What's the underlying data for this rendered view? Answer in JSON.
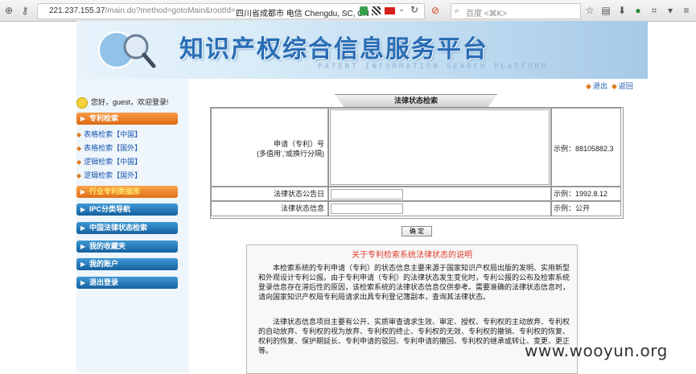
{
  "browser": {
    "url_host": "221.237.155.37",
    "url_path": "/main.do?method=gotoMain&rootId=",
    "geo_location": "四川省成都市 电信  Chengdu, SC, CN",
    "search_placeholder": "百度 <⌘K>"
  },
  "banner": {
    "title": "知识产权综合信息服务平台",
    "subtitle": "PATENT INFORMATION SEARCH PLATFORM"
  },
  "top_links": {
    "logout": "退出",
    "back": "返回"
  },
  "sidebar": {
    "welcome": "您好，guest，欢迎登录!",
    "section_patent": "专利检索",
    "sublinks": [
      "表格检索【中国】",
      "表格检索【国外】",
      "逻辑检索【中国】",
      "逻辑检索【国外】"
    ],
    "buttons": [
      "行业专利数据库",
      "IPC分类导航",
      "中国法律状态检索",
      "我的收藏夹",
      "我的账户",
      "退出登录"
    ]
  },
  "form": {
    "tab_title": "法律状态检索",
    "field1_label_line1": "申请（专利）号",
    "field1_label_line2": "(多值用','或换行分隔)",
    "field1_example": "示例：88105882.3",
    "field2_label": "法律状态公告日",
    "field2_example": "示例：1992.8.12",
    "field3_label": "法律状态信息",
    "field3_example": "示例：公开",
    "confirm": "确 定"
  },
  "notice": {
    "title": "关于专利检索系统法律状态的说明",
    "para1": "本检索系统的专利申请（专利）的状态信息主要来源于国家知识产权局出版的发明、实用新型和外观设计专利公报。由于专利申请（专利）的法律状态发生变化时，专利公报的公布及检索系统登录信息存在滞后性的原因，该检索系统的法律状态信息仅供参考。需要准确的法律状态信息时，请向国家知识产权局专利局请求出具专利登记簿副本，查询其法律状态。",
    "para2": "法律状态信息项目主要有公开、实质审查请求生效、审定、授权、专利权的主动放弃、专利权的自动放弃、专利权的视为放弃、专利权的终止、专利权的无效、专利权的撤销、专利权的恢复、权利的恢复、保护期延长、专利申请的驳回、专利申请的撤回、专利权的继承或转让、变更、更正等。"
  },
  "watermark": "www.wooyun.org",
  "colors": {
    "orange_button": "#e0701a",
    "blue_button": "#15609e",
    "link": "#1a56b0",
    "notice_title": "#e03b2c"
  }
}
